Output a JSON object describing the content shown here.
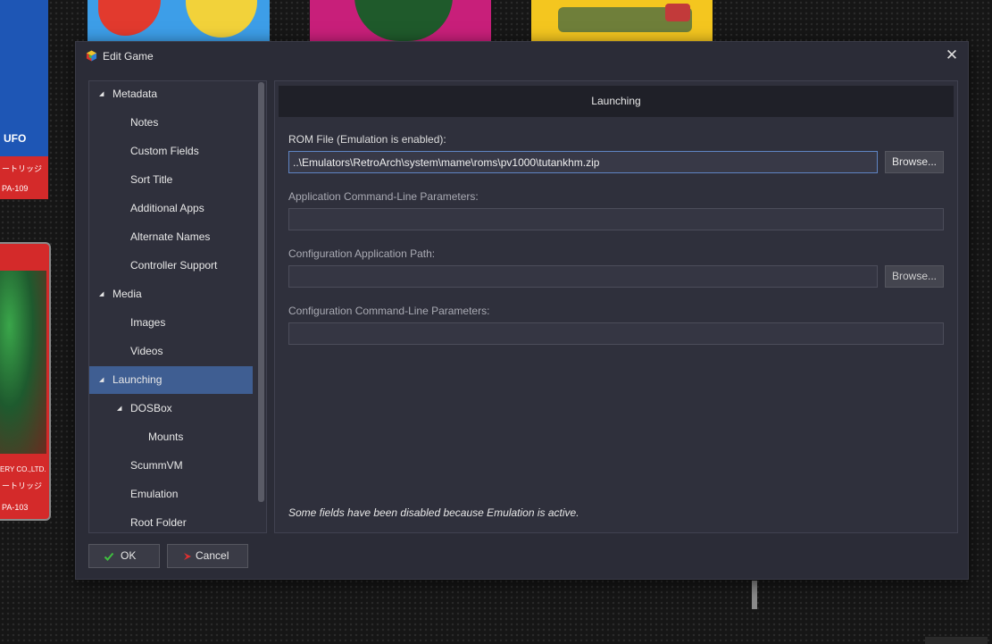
{
  "background": {
    "left_card_top": {
      "logo_text": "UFO",
      "subtitle_text": "ートリッジ",
      "code_text": "PA-109"
    },
    "left_card_bottom": {
      "publisher_text": "ERY CO.,LTD.",
      "subtitle_text": "ートリッジ",
      "code_text": "PA-103"
    }
  },
  "dialog": {
    "title": "Edit Game",
    "icon": "launchbox-cube-icon",
    "close_icon": "close-icon",
    "close_label": "✕"
  },
  "tree": {
    "expander_glyph": "◢",
    "items": [
      {
        "label": "Metadata",
        "level": 0,
        "expander": true
      },
      {
        "label": "Notes",
        "level": 1,
        "expander": false
      },
      {
        "label": "Custom Fields",
        "level": 1,
        "expander": false
      },
      {
        "label": "Sort Title",
        "level": 1,
        "expander": false
      },
      {
        "label": "Additional Apps",
        "level": 1,
        "expander": false
      },
      {
        "label": "Alternate Names",
        "level": 1,
        "expander": false
      },
      {
        "label": "Controller Support",
        "level": 1,
        "expander": false
      },
      {
        "label": "Media",
        "level": 0,
        "expander": true
      },
      {
        "label": "Images",
        "level": 1,
        "expander": false
      },
      {
        "label": "Videos",
        "level": 1,
        "expander": false
      },
      {
        "label": "Launching",
        "level": 0,
        "expander": true,
        "selected": true
      },
      {
        "label": "DOSBox",
        "level": 1,
        "expander": true
      },
      {
        "label": "Mounts",
        "level": 2,
        "expander": false
      },
      {
        "label": "ScummVM",
        "level": 1,
        "expander": false
      },
      {
        "label": "Emulation",
        "level": 1,
        "expander": false
      },
      {
        "label": "Root Folder",
        "level": 1,
        "expander": false
      }
    ]
  },
  "launching": {
    "header": "Launching",
    "rom_file": {
      "label": "ROM File (Emulation is enabled):",
      "value": "..\\Emulators\\RetroArch\\system\\mame\\roms\\pv1000\\tutankhm.zip",
      "browse_label": "Browse..."
    },
    "app_params": {
      "label": "Application Command-Line Parameters:",
      "value": ""
    },
    "config_path": {
      "label": "Configuration Application Path:",
      "value": "",
      "browse_label": "Browse..."
    },
    "config_params": {
      "label": "Configuration Command-Line Parameters:",
      "value": ""
    },
    "notice": "Some fields have been disabled because Emulation is active."
  },
  "footer": {
    "ok_label": "OK",
    "ok_icon": "checkmark-icon",
    "cancel_label": "Cancel",
    "cancel_icon": "cancel-arrow-icon"
  },
  "colors": {
    "dialog_bg": "#2b2c37",
    "panel_bg": "#2f303c",
    "header_bg": "#1f2028",
    "selection": "#3f5e92",
    "ok_green": "#3fbf3f",
    "cancel_red": "#e03030"
  }
}
